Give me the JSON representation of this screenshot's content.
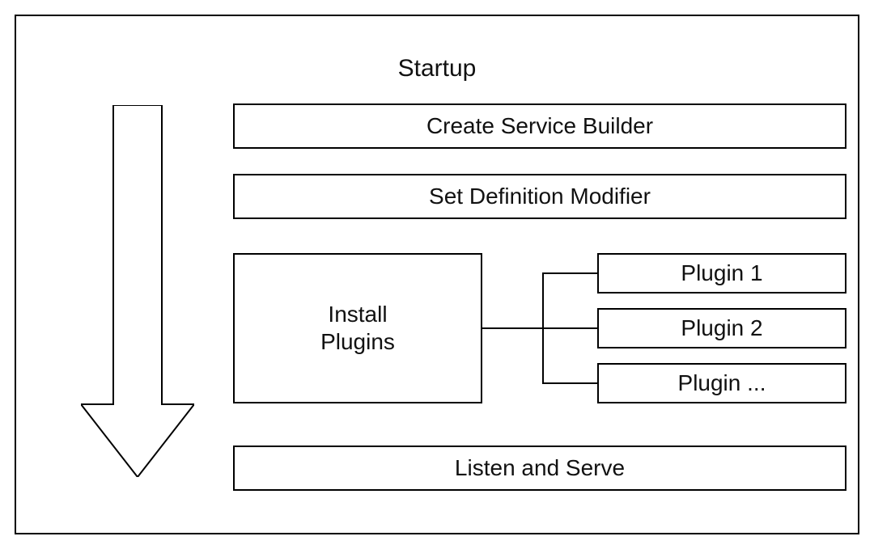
{
  "title": "Startup",
  "steps": {
    "s1": "Create Service Builder",
    "s2": "Set Definition Modifier",
    "install": "Install\nPlugins",
    "s4": "Listen and Serve"
  },
  "plugins": {
    "p1": "Plugin 1",
    "p2": "Plugin 2",
    "p3": "Plugin ..."
  }
}
